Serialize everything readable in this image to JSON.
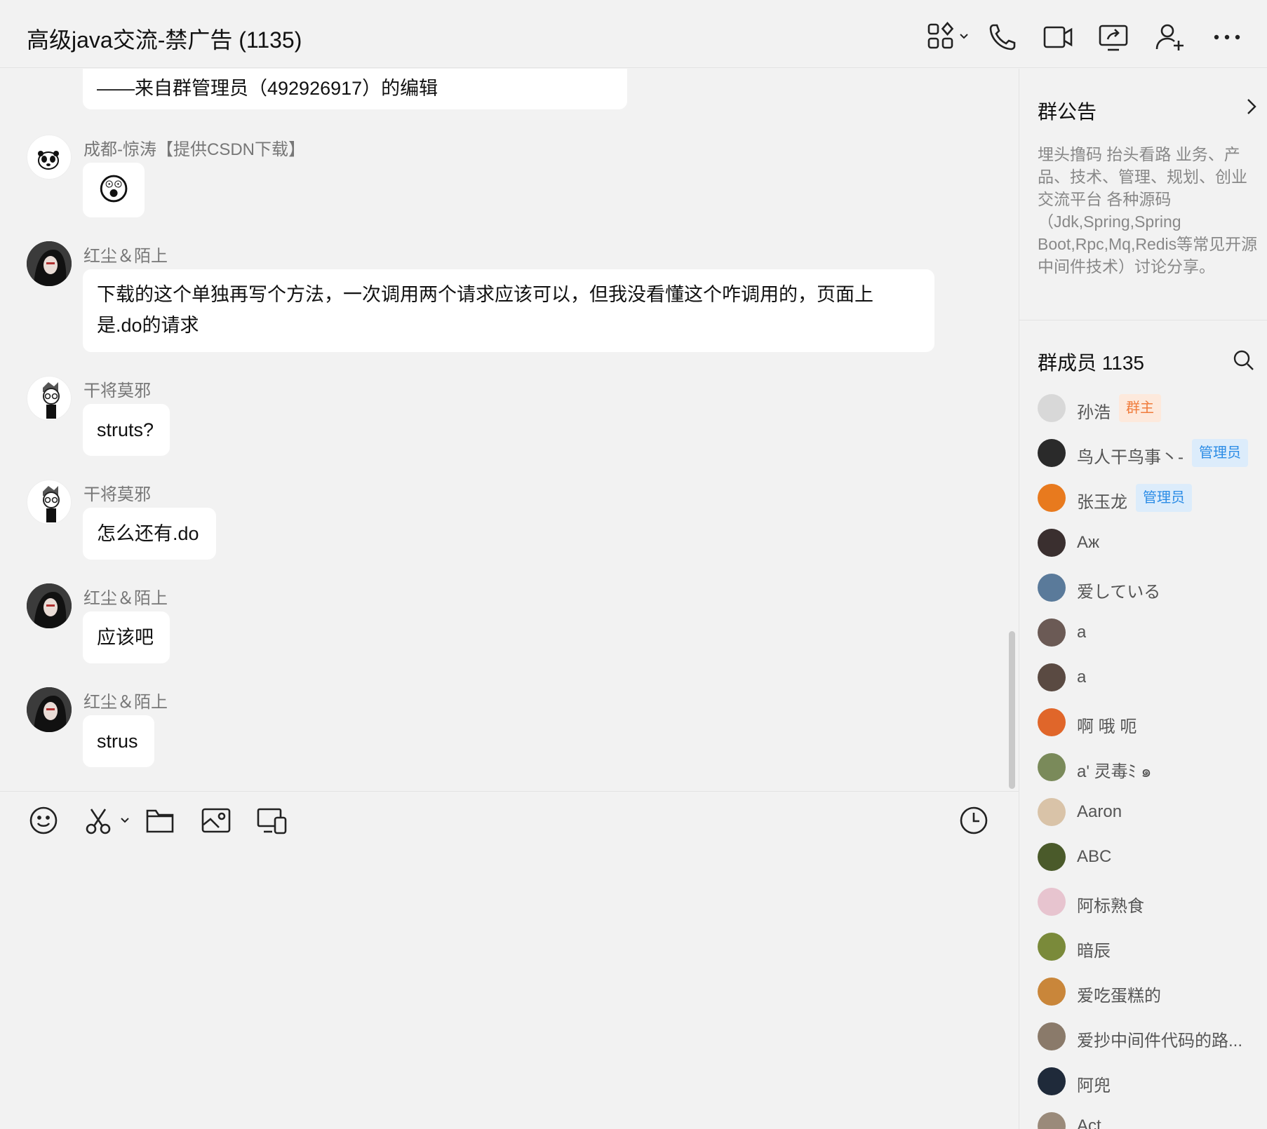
{
  "header": {
    "title": "高级java交流-禁广告 (1135)"
  },
  "messages": [
    {
      "sender": "",
      "text": "——来自群管理员（492926917）的编辑"
    },
    {
      "sender": "成都-惊涛【提供CSDN下载】",
      "text": "😲"
    },
    {
      "sender": "红尘＆陌上",
      "text_line1": "下载的这个单独再写个方法，一次调用两个请求应该可以，但我没看懂这个咋调用的，页面上",
      "text_line2": "是.do的请求"
    },
    {
      "sender": "干将莫邪",
      "text": "struts?"
    },
    {
      "sender": "干将莫邪",
      "text": "怎么还有.do"
    },
    {
      "sender": "红尘＆陌上",
      "text": "应该吧"
    },
    {
      "sender": "红尘＆陌上",
      "text": "strus"
    }
  ],
  "panel": {
    "announcement_title": "群公告",
    "announcement_text": "埋头撸码 抬头看路 业务、产品、技术、管理、规划、创业交流平台 各种源码（Jdk,Spring,Spring Boot,Rpc,Mq,Redis等常见开源中间件技术）讨论分享。",
    "members_title": "群成员 1135",
    "members": [
      {
        "name": "孙浩",
        "badge": "群主",
        "color": "#d8d8d8"
      },
      {
        "name": "鸟人干鸟事丶-",
        "badge": "管理员",
        "color": "#2a2a2a"
      },
      {
        "name": "张玉龙",
        "badge": "管理员",
        "color": "#e87a1e"
      },
      {
        "name": "Аж",
        "badge": "",
        "color": "#3a2f2f"
      },
      {
        "name": "爱している",
        "badge": "",
        "color": "#5a7a9a"
      },
      {
        "name": "a",
        "badge": "",
        "color": "#6b5a55"
      },
      {
        "name": "a",
        "badge": "",
        "color": "#5a4a42"
      },
      {
        "name": "啊 哦 呃",
        "badge": "",
        "color": "#e0662a"
      },
      {
        "name": "a' 灵毒ﾐ ๑",
        "badge": "",
        "color": "#7a8a5a"
      },
      {
        "name": "Aaron",
        "badge": "",
        "color": "#d9c3a8"
      },
      {
        "name": "ABC",
        "badge": "",
        "color": "#4a5a2a"
      },
      {
        "name": "阿标熟食",
        "badge": "",
        "color": "#e7c4cf"
      },
      {
        "name": "暗辰",
        "badge": "",
        "color": "#7a8a3a"
      },
      {
        "name": "爱吃蛋糕的",
        "badge": "",
        "color": "#c9863a"
      },
      {
        "name": "爱抄中间件代码的路...",
        "badge": "",
        "color": "#8a7a6a"
      },
      {
        "name": "阿兜",
        "badge": "",
        "color": "#1f2a3a"
      },
      {
        "name": "Act",
        "badge": "",
        "color": "#9a8a7a"
      }
    ]
  }
}
